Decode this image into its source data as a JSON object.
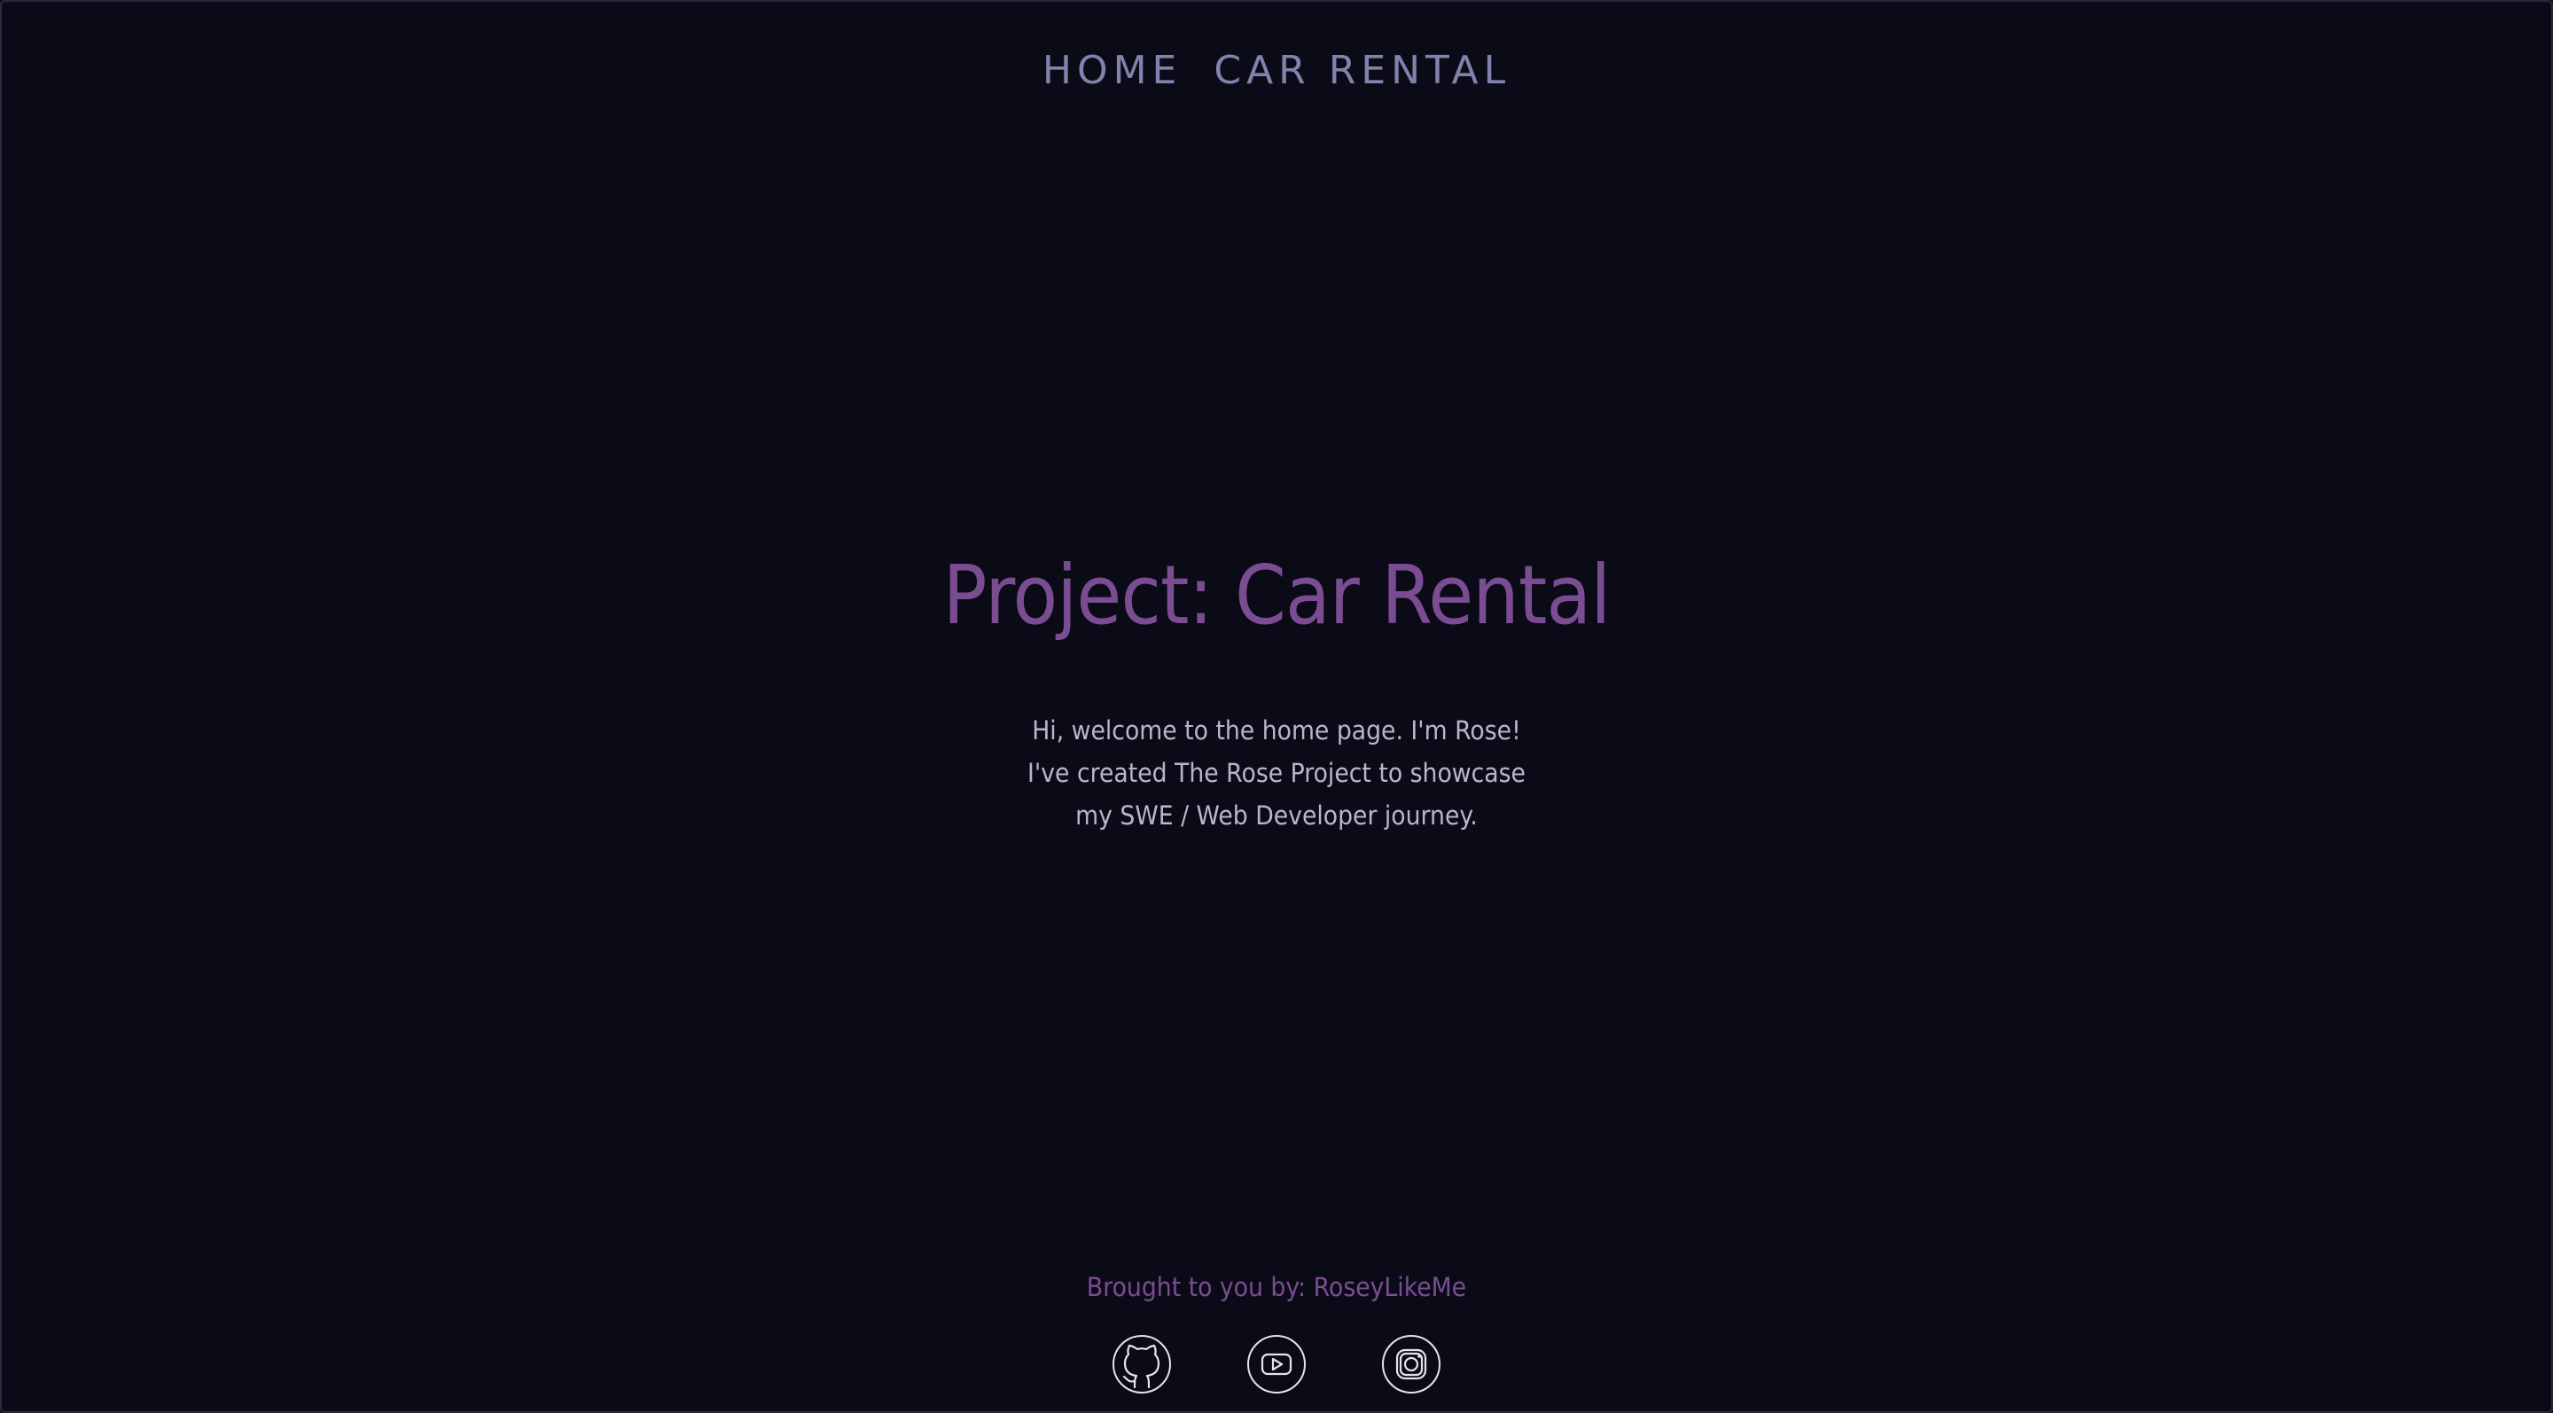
{
  "nav": {
    "items": [
      {
        "label": "HOME"
      },
      {
        "label": "CAR RENTAL"
      }
    ]
  },
  "hero": {
    "title": "Project: Car Rental",
    "intro_lines": [
      "Hi, welcome to the home page. I'm Rose!",
      "I've created The Rose Project to showcase",
      "my SWE / Web Developer journey."
    ]
  },
  "footer": {
    "credit": "Brought to you by: RoseyLikeMe",
    "socials": [
      {
        "icon": "github-icon"
      },
      {
        "icon": "youtube-icon"
      },
      {
        "icon": "instagram-icon"
      }
    ]
  },
  "colors": {
    "background": "#0b0b18",
    "nav_text": "#8283ad",
    "accent": "#7a4d93",
    "body_text": "#b7b7c9",
    "icon_stroke": "#e4e4ee"
  }
}
